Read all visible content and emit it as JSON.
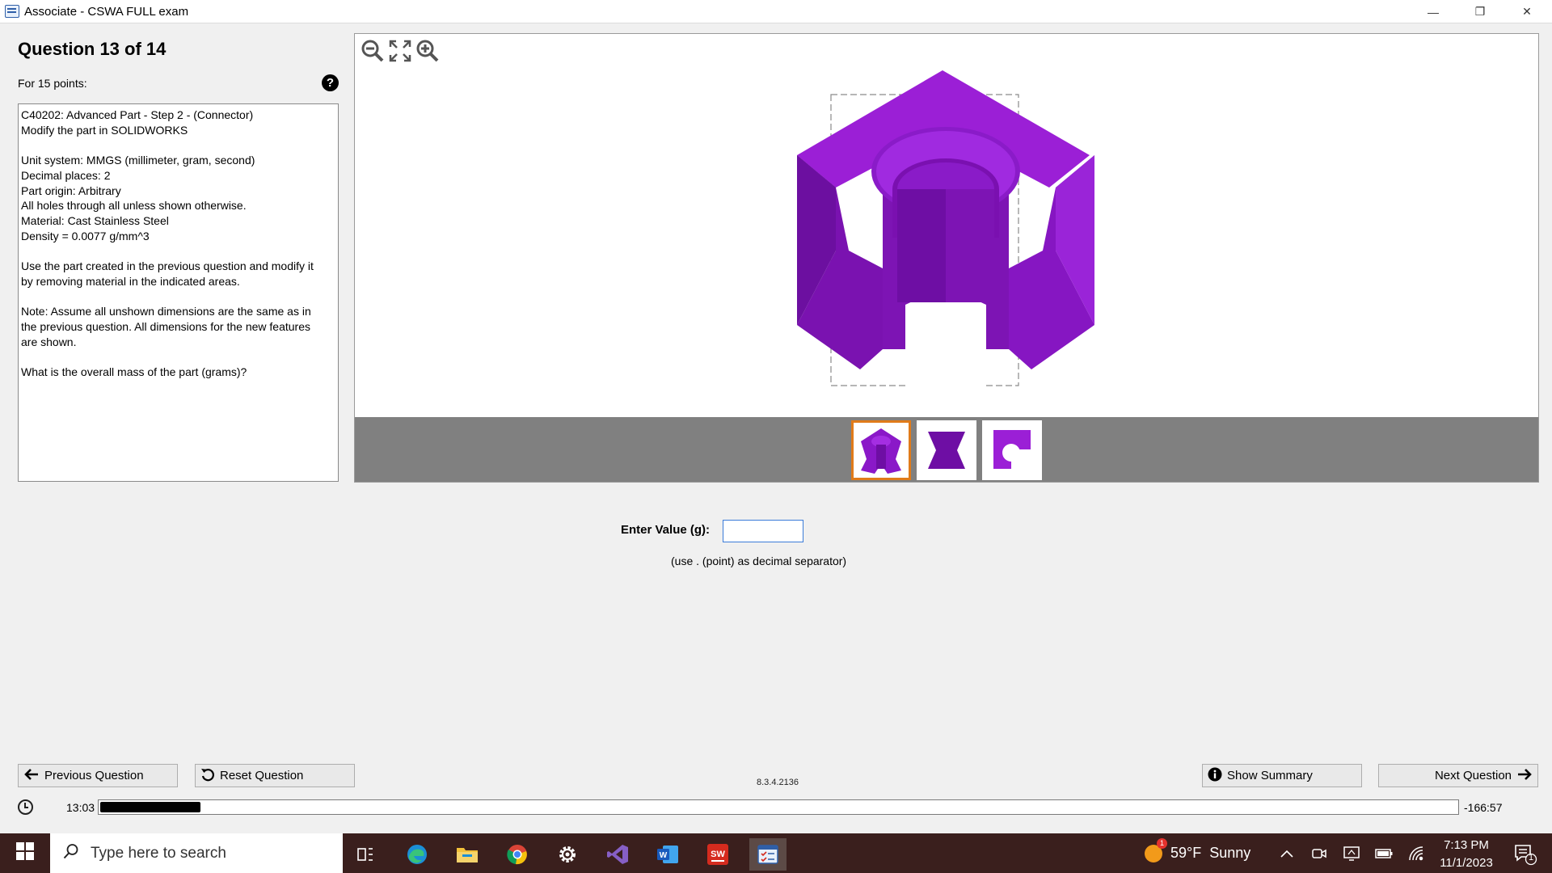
{
  "window": {
    "title": "Associate - CSWA FULL exam",
    "minimize_glyph": "—",
    "maximize_glyph": "❐",
    "close_glyph": "✕"
  },
  "question": {
    "title": "Question 13 of 14",
    "points": "For 15 points:",
    "help_glyph": "?",
    "paragraphs": [
      [
        "C40202:  Advanced Part - Step 2 - (Connector)",
        "Modify the part in SOLIDWORKS"
      ],
      [
        "Unit system: MMGS (millimeter, gram, second)",
        "Decimal places: 2",
        "Part origin: Arbitrary",
        "All holes through all unless shown otherwise.",
        "Material: Cast Stainless Steel",
        "Density = 0.0077 g/mm^3"
      ],
      [
        "Use the part created in the previous question and modify it",
        "by removing material in the indicated areas."
      ],
      [
        "Note: Assume all unshown dimensions are the same as in",
        "the previous question.  All dimensions for the new features",
        "are shown."
      ],
      [
        "What is the overall mass of the part (grams)?"
      ]
    ]
  },
  "viewer": {
    "tools": [
      "zoom-out-icon",
      "fit-to-window-icon",
      "zoom-in-icon"
    ],
    "part_color": "#9b1fd6",
    "thumbnails": [
      {
        "name": "isometric-view",
        "selected": true
      },
      {
        "name": "front-view",
        "selected": false
      },
      {
        "name": "top-view",
        "selected": false
      }
    ]
  },
  "answer": {
    "label": "Enter Value (g):",
    "value": "",
    "hint": "(use . (point) as decimal separator)"
  },
  "nav": {
    "previous": "Previous Question",
    "reset": "Reset Question",
    "summary": "Show Summary",
    "next": "Next Question",
    "version": "8.3.4.2136"
  },
  "timer": {
    "elapsed": "13:03",
    "remaining": "-166:57",
    "progress_fraction": 0.074
  },
  "taskbar": {
    "search_placeholder": "Type here to search",
    "apps": [
      "task-view-icon",
      "edge-icon",
      "file-explorer-icon",
      "chrome-icon",
      "settings-icon",
      "visual-studio-icon",
      "word-icon",
      "solidworks-icon",
      "exam-app-icon"
    ],
    "weather_temp": "59°F",
    "weather_desc": "Sunny",
    "weather_badge": "1",
    "time": "7:13 PM",
    "date": "11/1/2023",
    "notification_count": "1"
  }
}
